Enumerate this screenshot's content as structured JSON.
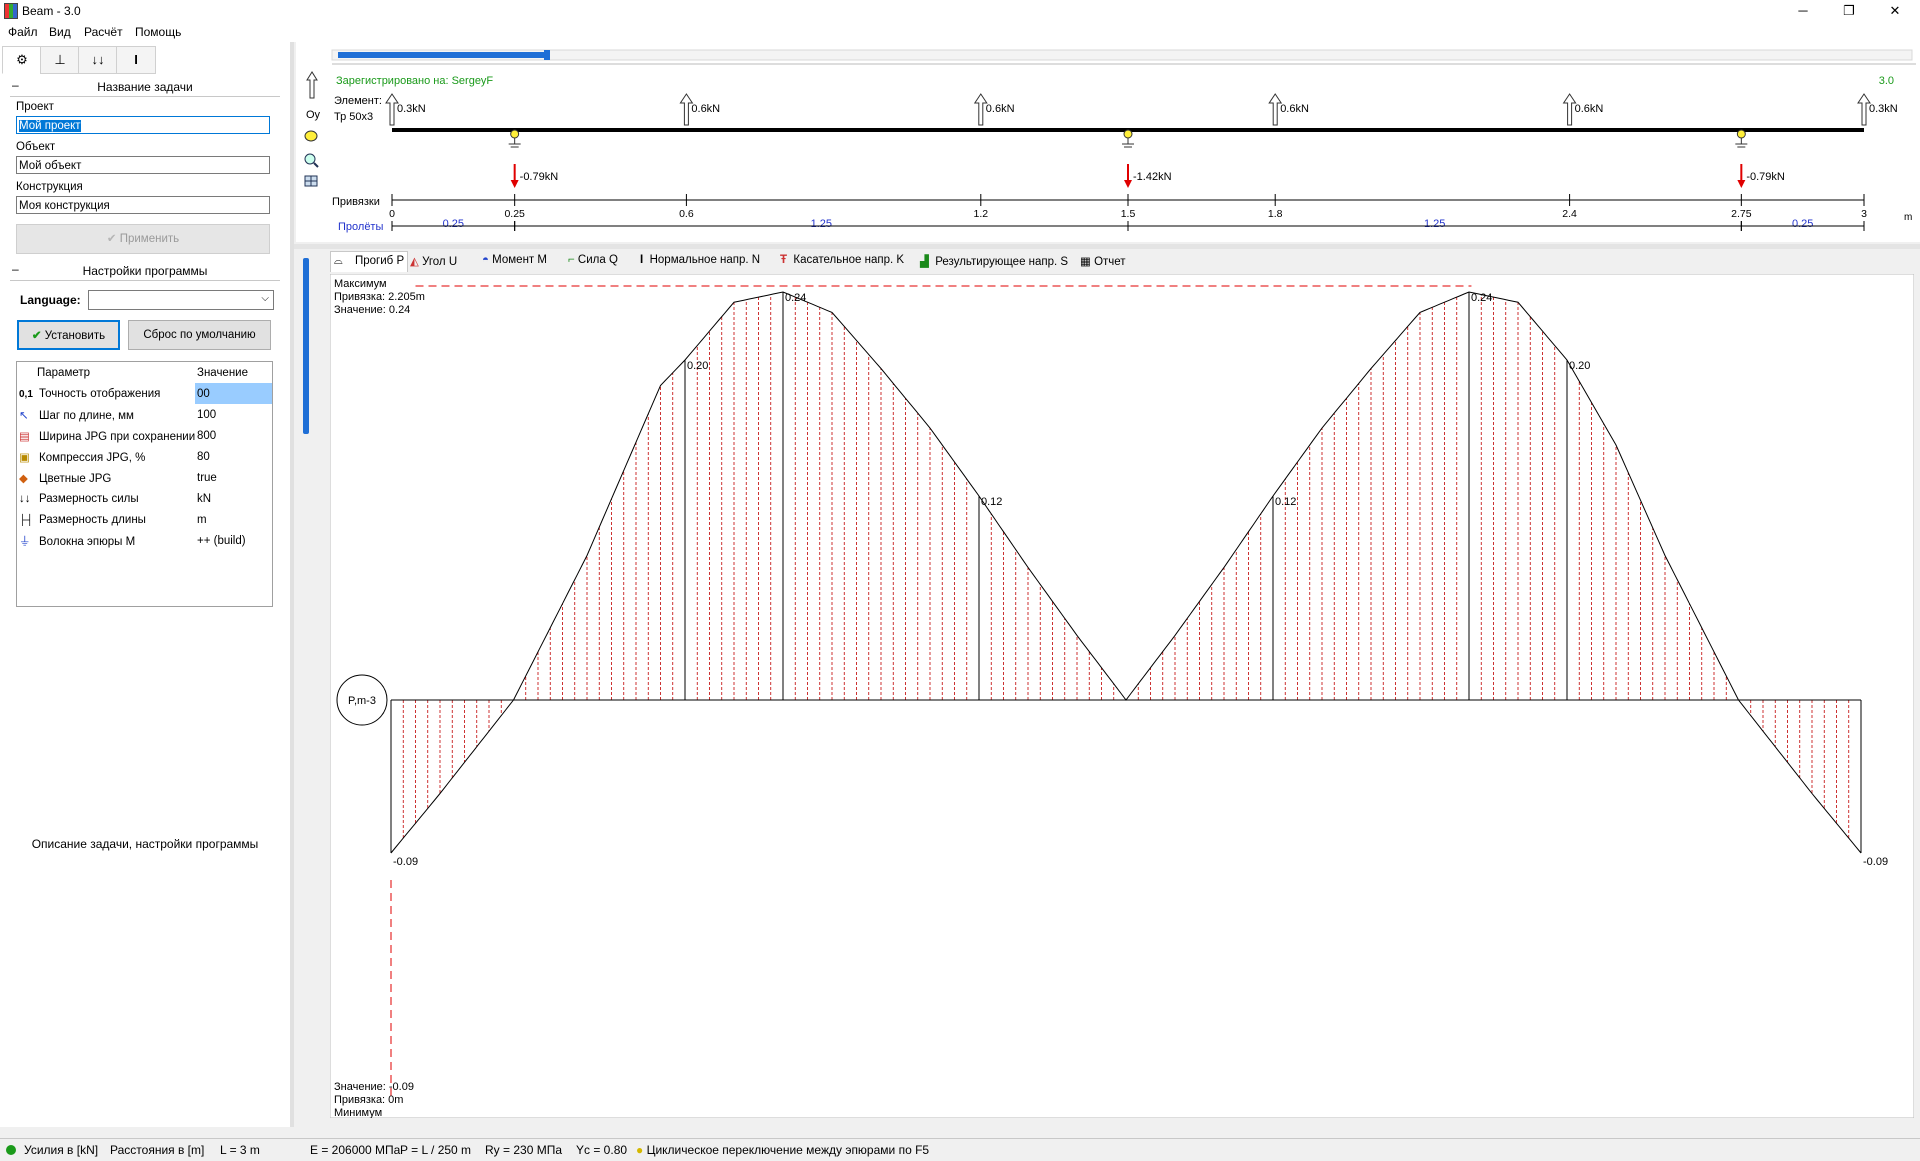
{
  "window": {
    "title": "Beam - 3.0",
    "minimize": "─",
    "maximize": "❐",
    "close": "✕"
  },
  "menu": [
    "Файл",
    "Вид",
    "Расчёт",
    "Помощь"
  ],
  "left": {
    "section1": "Название задачи",
    "project_label": "Проект",
    "project_value": "Мой проект",
    "object_label": "Объект",
    "object_value": "Мой объект",
    "construction_label": "Конструкция",
    "construction_value": "Моя конструкция",
    "apply": "Применить",
    "section2": "Настройки программы",
    "language_label": "Language:",
    "install": "Установить",
    "reset": "Сброс по умолчанию",
    "params_header": [
      "Параметр",
      "Значение"
    ],
    "params": [
      {
        "icon": "0,1",
        "name": "Точность отображения",
        "value": "00"
      },
      {
        "icon": "↖",
        "name": "Шаг по длине, мм",
        "value": "100"
      },
      {
        "icon": "▤",
        "name": "Ширина JPG при сохранении, р",
        "value": "800"
      },
      {
        "icon": "▣",
        "name": "Компрессия JPG, %",
        "value": "80"
      },
      {
        "icon": "◆",
        "name": "Цветные JPG",
        "value": "true"
      },
      {
        "icon": "↓↓",
        "name": "Размерность силы",
        "value": "kN"
      },
      {
        "icon": "├┤",
        "name": "Размерность длины",
        "value": "m"
      },
      {
        "icon": "⏚",
        "name": "Волокна эпюры М",
        "value": "++ (build)"
      }
    ],
    "description": "Описание задачи, настройки программы"
  },
  "scheme": {
    "registered": "Зарегистрировано на: SergeyF",
    "version": "3.0",
    "oy": "Oy",
    "element_label": "Элемент:",
    "element_value": "Тр 50x3",
    "up_loads": [
      {
        "x": 0,
        "label": "0.3kN"
      },
      {
        "x": 0.6,
        "label": "0.6kN"
      },
      {
        "x": 1.2,
        "label": "0.6kN"
      },
      {
        "x": 1.8,
        "label": "0.6kN"
      },
      {
        "x": 2.4,
        "label": "0.6kN"
      },
      {
        "x": 3,
        "label": "0.3kN"
      }
    ],
    "supports": [
      0.25,
      1.5,
      2.75
    ],
    "reactions": [
      {
        "x": 0.25,
        "label": "-0.79kN"
      },
      {
        "x": 1.5,
        "label": "-1.42kN"
      },
      {
        "x": 2.75,
        "label": "-0.79kN"
      }
    ],
    "bindings_label": "Привязки",
    "ticks": [
      {
        "x": 0,
        "label": "0"
      },
      {
        "x": 0.25,
        "label": "0.25"
      },
      {
        "x": 0.6,
        "label": "0.6"
      },
      {
        "x": 1.2,
        "label": "1.2"
      },
      {
        "x": 1.5,
        "label": "1.5"
      },
      {
        "x": 1.8,
        "label": "1.8"
      },
      {
        "x": 2.4,
        "label": "2.4"
      },
      {
        "x": 2.75,
        "label": "2.75"
      },
      {
        "x": 3,
        "label": "3"
      }
    ],
    "unit": "m",
    "spans_label": "Пролёты",
    "spans": [
      {
        "from": 0,
        "to": 0.25,
        "label": "0.25"
      },
      {
        "from": 0.25,
        "to": 1.5,
        "label": "1.25"
      },
      {
        "from": 1.5,
        "to": 2.75,
        "label": "1.25"
      },
      {
        "from": 2.75,
        "to": 3,
        "label": "0.25"
      }
    ]
  },
  "result_tabs": [
    "Прогиб P",
    "Угол U",
    "Момент M",
    "Сила Q",
    "Нормальное напр. N",
    "Касательное напр. K",
    "Результирующее напр. S",
    "Отчет"
  ],
  "diagram": {
    "badge": "P,m-3",
    "max_title": "Максимум",
    "max_binding": "Привязка: 2.205m",
    "max_value": "Значение: 0.24",
    "min_value": "Значение: -0.09",
    "min_binding": "Привязка: 0m",
    "min_title": "Минимум"
  },
  "chart_data": {
    "type": "line",
    "xlim": [
      0,
      3
    ],
    "ylim": [
      -0.09,
      0.24
    ],
    "x": [
      0,
      0.1,
      0.25,
      0.4,
      0.55,
      0.6,
      0.7,
      0.8,
      0.9,
      1.0,
      1.1,
      1.2,
      1.3,
      1.4,
      1.5,
      1.6,
      1.7,
      1.8,
      1.9,
      2.0,
      2.1,
      2.2,
      2.3,
      2.4,
      2.5,
      2.6,
      2.75,
      2.9,
      3.0
    ],
    "y": [
      -0.09,
      -0.055,
      0.0,
      0.085,
      0.185,
      0.2,
      0.234,
      0.24,
      0.228,
      0.195,
      0.16,
      0.12,
      0.078,
      0.038,
      0.0,
      0.038,
      0.078,
      0.12,
      0.16,
      0.195,
      0.228,
      0.24,
      0.234,
      0.2,
      0.15,
      0.085,
      0.0,
      -0.055,
      -0.09
    ],
    "labels": [
      {
        "x": 0,
        "value": "-0.09"
      },
      {
        "x": 0.6,
        "value": "0.20"
      },
      {
        "x": 0.8,
        "value": "0.24"
      },
      {
        "x": 1.2,
        "value": "0.12"
      },
      {
        "x": 1.8,
        "value": "0.12"
      },
      {
        "x": 2.2,
        "value": "0.24"
      },
      {
        "x": 2.4,
        "value": "0.20"
      },
      {
        "x": 3,
        "value": "-0.09"
      }
    ]
  },
  "status": [
    "Усилия в [kN]",
    "Расстояния в [m]",
    "L = 3 m",
    "E = 206000 МПа",
    "P = L / 250 m",
    "Ry = 230 МПа",
    "Yc = 0.80",
    "Циклическое переключение между эпюрами по F5"
  ]
}
